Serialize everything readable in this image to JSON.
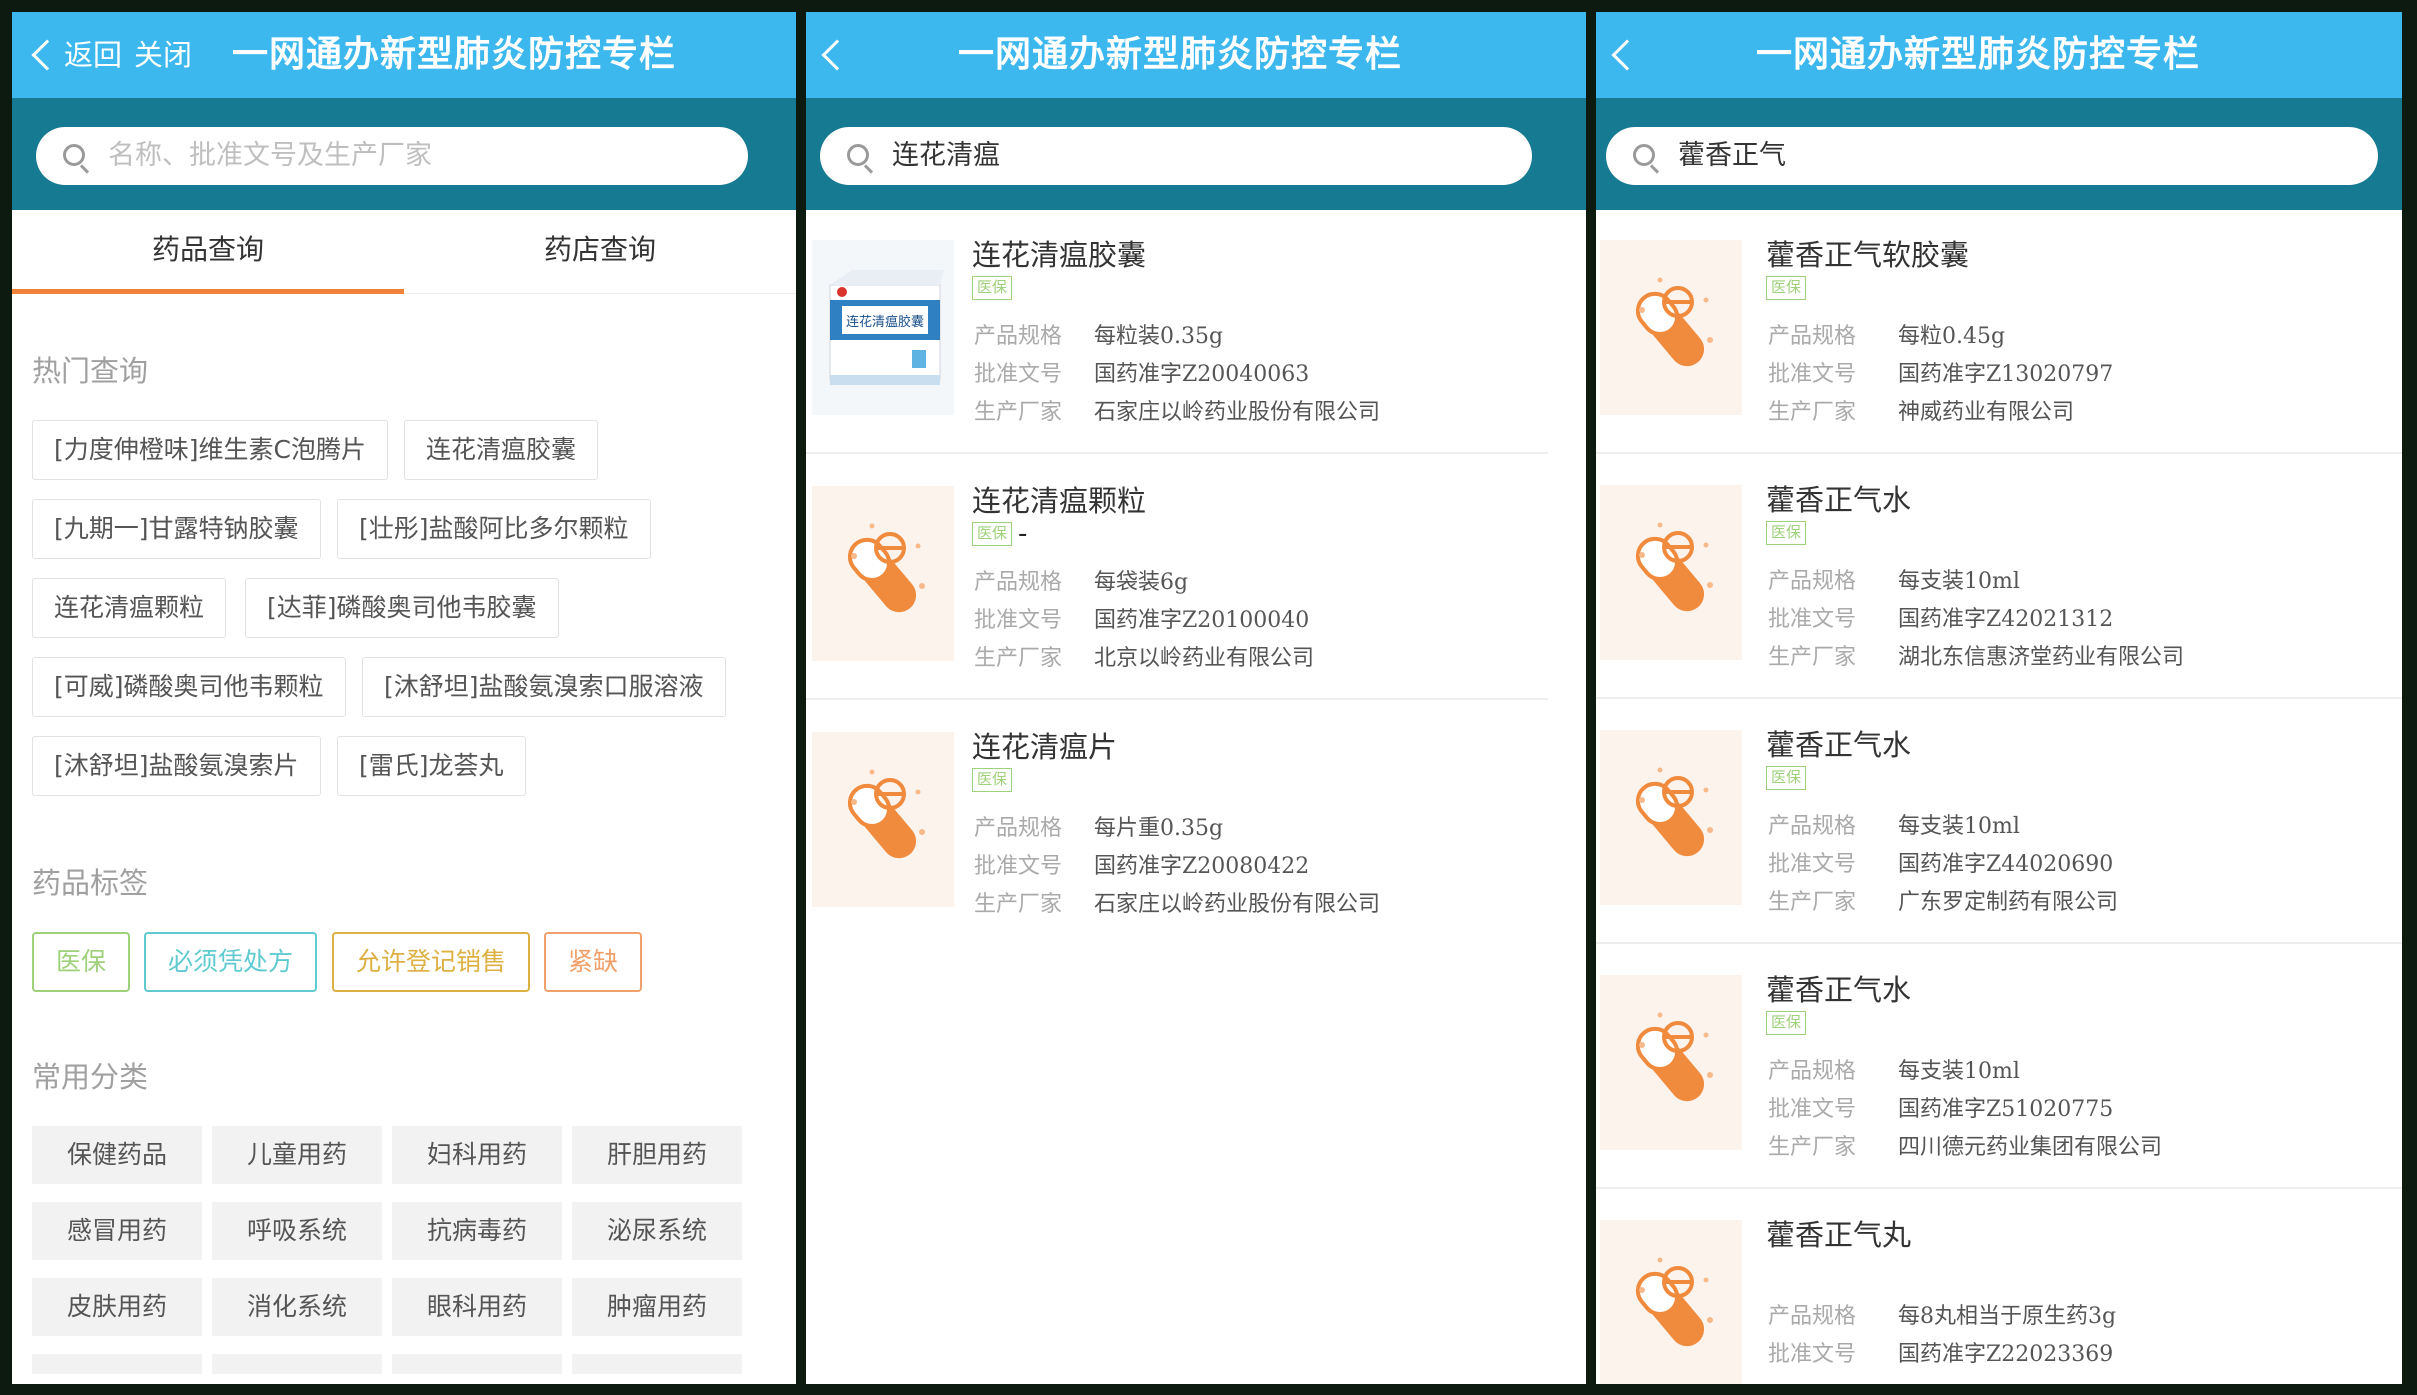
{
  "panel1": {
    "back_label": "返回",
    "close_label": "关闭",
    "title": "一网通办新型肺炎防控专栏",
    "search_placeholder": "名称、批准文号及生产厂家",
    "tabs": [
      "药品查询",
      "药店查询"
    ],
    "hot_title": "热门查询",
    "hot_items": [
      "[力度伸橙味]维生素C泡腾片",
      "连花清瘟胶囊",
      "[九期一]甘露特钠胶囊",
      "[壮彤]盐酸阿比多尔颗粒",
      "连花清瘟颗粒",
      "[达菲]磷酸奥司他韦胶囊",
      "[可威]磷酸奥司他韦颗粒",
      "[沐舒坦]盐酸氨溴索口服溶液",
      "[沐舒坦]盐酸氨溴索片",
      "[雷氏]龙荟丸"
    ],
    "tag_title": "药品标签",
    "tags": [
      {
        "label": "医保",
        "color": "#9fd07a"
      },
      {
        "label": "必须凭处方",
        "color": "#5fcbd0"
      },
      {
        "label": "允许登记销售",
        "color": "#dcb042"
      },
      {
        "label": "紧缺",
        "color": "#f0a06a"
      }
    ],
    "cat_title": "常用分类",
    "categories": [
      "保健药品",
      "儿童用药",
      "妇科用药",
      "肝胆用药",
      "感冒用药",
      "呼吸系统",
      "抗病毒药",
      "泌尿系统",
      "皮肤用药",
      "消化系统",
      "眼科用药",
      "肿瘤用药"
    ]
  },
  "panel2": {
    "title": "一网通办新型肺炎防控专栏",
    "search_value": "连花清瘟",
    "results": [
      {
        "name": "连花清瘟胶囊",
        "badge": "医保",
        "spec_label": "产品规格",
        "spec": "每粒装0.35g",
        "approval_label": "批准文号",
        "approval": "国药准字Z20040063",
        "maker_label": "生产厂家",
        "maker": "石家庄以岭药业股份有限公司"
      },
      {
        "name": "连花清瘟颗粒",
        "badge": "医保",
        "spec_label": "产品规格",
        "spec": "每袋装6g",
        "approval_label": "批准文号",
        "approval": "国药准字Z20100040",
        "maker_label": "生产厂家",
        "maker": "北京以岭药业有限公司"
      },
      {
        "name": "连花清瘟片",
        "badge": "医保",
        "spec_label": "产品规格",
        "spec": "每片重0.35g",
        "approval_label": "批准文号",
        "approval": "国药准字Z20080422",
        "maker_label": "生产厂家",
        "maker": "石家庄以岭药业股份有限公司"
      }
    ],
    "box_label": "连花清瘟胶囊"
  },
  "panel3": {
    "title": "一网通办新型肺炎防控专栏",
    "search_value": "藿香正气",
    "results": [
      {
        "name": "藿香正气软胶囊",
        "badge": "医保",
        "spec_label": "产品规格",
        "spec": "每粒0.45g",
        "approval_label": "批准文号",
        "approval": "国药准字Z13020797",
        "maker_label": "生产厂家",
        "maker": "神威药业有限公司"
      },
      {
        "name": "藿香正气水",
        "badge": "医保",
        "spec_label": "产品规格",
        "spec": "每支装10ml",
        "approval_label": "批准文号",
        "approval": "国药准字Z42021312",
        "maker_label": "生产厂家",
        "maker": "湖北东信惠济堂药业有限公司"
      },
      {
        "name": "藿香正气水",
        "badge": "医保",
        "spec_label": "产品规格",
        "spec": "每支装10ml",
        "approval_label": "批准文号",
        "approval": "国药准字Z44020690",
        "maker_label": "生产厂家",
        "maker": "广东罗定制药有限公司"
      },
      {
        "name": "藿香正气水",
        "badge": "医保",
        "spec_label": "产品规格",
        "spec": "每支装10ml",
        "approval_label": "批准文号",
        "approval": "国药准字Z51020775",
        "maker_label": "生产厂家",
        "maker": "四川德元药业集团有限公司"
      },
      {
        "name": "藿香正气丸",
        "spec_label": "产品规格",
        "spec": "每8丸相当于原生药3g",
        "approval_label": "批准文号",
        "approval": "国药准字Z22023369"
      }
    ]
  },
  "colors": {
    "header": "#3cb8ef",
    "search_band": "#167a92",
    "tab_accent": "#f0823c"
  }
}
